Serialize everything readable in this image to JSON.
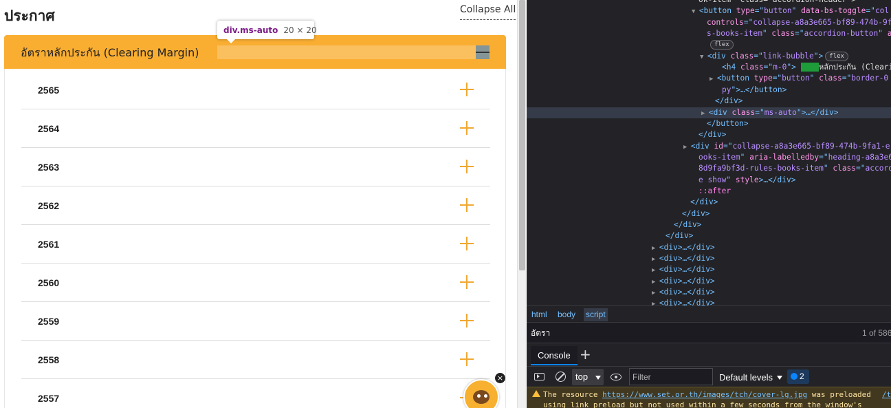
{
  "page": {
    "title": "ประกาศ",
    "collapse_all": "Collapse All",
    "tooltip": {
      "tag": "div",
      "class": ".ms-auto",
      "dims": "20 × 20"
    },
    "accordion": {
      "title": "อัตราหลักประกัน (Clearing Margin)",
      "years": [
        "2565",
        "2564",
        "2563",
        "2562",
        "2561",
        "2560",
        "2559",
        "2558",
        "2557"
      ]
    },
    "chat_close": "×",
    "colors": {
      "accent": "#f9ae32",
      "plus": "#f0a830"
    }
  },
  "devtools": {
    "dom_lines": [
      {
        "indent": 1016,
        "parts": [
          [
            "tx",
            "ok‑item\" class=\"accordion‑header\">"
          ]
        ]
      },
      {
        "indent": 1016,
        "tw": "▼",
        "parts": [
          [
            "tg",
            "<button "
          ],
          [
            "an",
            "type"
          ],
          [
            "tg",
            "=\""
          ],
          [
            "av",
            "button"
          ],
          [
            "tg",
            "\" "
          ],
          [
            "an",
            "data-bs-toggle"
          ],
          [
            "tg",
            "=\""
          ],
          [
            "av",
            "col"
          ]
        ]
      },
      {
        "indent": 1028,
        "parts": [
          [
            "an",
            "controls"
          ],
          [
            "tg",
            "=\""
          ],
          [
            "av",
            "collapse-a8a3e665-bf89-474b-9fa"
          ]
        ]
      },
      {
        "indent": 1028,
        "parts": [
          [
            "av",
            "s-books-item"
          ],
          [
            "tg",
            "\" "
          ],
          [
            "an",
            "class"
          ],
          [
            "tg",
            "=\""
          ],
          [
            "av",
            "accordion-button"
          ],
          [
            "tg",
            "\" "
          ],
          [
            "an",
            "ar"
          ]
        ]
      },
      {
        "indent": 1030,
        "badge": "flex"
      },
      {
        "indent": 1028,
        "tw": "▼",
        "parts": [
          [
            "tg",
            "<div "
          ],
          [
            "an",
            "class"
          ],
          [
            "tg",
            "=\""
          ],
          [
            "av",
            "link-bubble"
          ],
          [
            "tg",
            "\">"
          ]
        ],
        "badge": "flex"
      },
      {
        "indent": 1050,
        "parts": [
          [
            "tg",
            "<h4 "
          ],
          [
            "an",
            "class"
          ],
          [
            "tg",
            "=\""
          ],
          [
            "av",
            "m-0"
          ],
          [
            "tg",
            "\"> "
          ]
        ],
        "match": "อัตรา",
        "tail": "หลักประกัน (Cleari"
      },
      {
        "indent": 1042,
        "tw": "▶",
        "parts": [
          [
            "tg",
            "<button "
          ],
          [
            "an",
            "type"
          ],
          [
            "tg",
            "=\""
          ],
          [
            "av",
            "button"
          ],
          [
            "tg",
            "\" "
          ],
          [
            "an",
            "class"
          ],
          [
            "tg",
            "=\""
          ],
          [
            "av",
            "border-0"
          ]
        ]
      },
      {
        "indent": 1050,
        "parts": [
          [
            "av",
            "py"
          ],
          [
            "tg",
            "\">…</button>"
          ]
        ]
      },
      {
        "indent": 1040,
        "parts": [
          [
            "tg",
            "</div>"
          ]
        ]
      },
      {
        "indent": 1030,
        "tw": "▶",
        "sel": true,
        "parts": [
          [
            "tg",
            "<div "
          ],
          [
            "an",
            "class"
          ],
          [
            "tg",
            "=\""
          ],
          [
            "av",
            "ms-auto"
          ],
          [
            "tg",
            "\">…</div>"
          ]
        ]
      },
      {
        "indent": 1028,
        "parts": [
          [
            "tg",
            "</button>"
          ]
        ]
      },
      {
        "indent": 1016,
        "parts": [
          [
            "tg",
            "</div>"
          ]
        ]
      },
      {
        "indent": 1004,
        "tw": "▶",
        "parts": [
          [
            "tg",
            "<div "
          ],
          [
            "an",
            "id"
          ],
          [
            "tg",
            "=\""
          ],
          [
            "av",
            "collapse-a8a3e665-bf89-474b-9fa1-e"
          ]
        ]
      },
      {
        "indent": 1016,
        "parts": [
          [
            "av",
            "ooks-item"
          ],
          [
            "tg",
            "\" "
          ],
          [
            "an",
            "aria-labelledby"
          ],
          [
            "tg",
            "=\""
          ],
          [
            "av",
            "heading-a8a3e66"
          ]
        ]
      },
      {
        "indent": 1016,
        "parts": [
          [
            "av",
            "8d9fa9bf3d-rules-books-item"
          ],
          [
            "tg",
            "\" "
          ],
          [
            "an",
            "class"
          ],
          [
            "tg",
            "=\""
          ],
          [
            "av",
            "accordi"
          ]
        ]
      },
      {
        "indent": 1016,
        "parts": [
          [
            "av",
            "e show"
          ],
          [
            "tg",
            "\" "
          ],
          [
            "an",
            "style"
          ],
          [
            "tg",
            ">…</div>"
          ]
        ]
      },
      {
        "indent": 1016,
        "parts": [
          [
            "pe",
            "::after"
          ]
        ]
      },
      {
        "indent": 1004,
        "parts": [
          [
            "tg",
            "</div>"
          ]
        ]
      },
      {
        "indent": 992,
        "parts": [
          [
            "tg",
            "</div>"
          ]
        ]
      },
      {
        "indent": 980,
        "parts": [
          [
            "tg",
            "</div>"
          ]
        ]
      },
      {
        "indent": 968,
        "parts": [
          [
            "tg",
            "</div>"
          ]
        ]
      },
      {
        "indent": 958,
        "tw": "▶",
        "parts": [
          [
            "tg",
            "<div>…</div>"
          ]
        ]
      },
      {
        "indent": 958,
        "tw": "▶",
        "parts": [
          [
            "tg",
            "<div>…</div>"
          ]
        ]
      },
      {
        "indent": 958,
        "tw": "▶",
        "parts": [
          [
            "tg",
            "<div>…</div>"
          ]
        ]
      },
      {
        "indent": 958,
        "tw": "▶",
        "parts": [
          [
            "tg",
            "<div>…</div>"
          ]
        ]
      },
      {
        "indent": 958,
        "tw": "▶",
        "parts": [
          [
            "tg",
            "<div>…</div>"
          ]
        ]
      },
      {
        "indent": 958,
        "tw": "▶",
        "parts": [
          [
            "tg",
            "<div>…</div>"
          ]
        ]
      }
    ],
    "breadcrumbs": [
      "html",
      "body",
      "script"
    ],
    "search": {
      "value": "อัตรา",
      "count": "1 of 586"
    },
    "console_tab": "Console",
    "add_tab": "+",
    "context": "top",
    "filter_placeholder": "Filter",
    "levels": "Default levels",
    "message_count": "2",
    "warning": {
      "prefix": "The resource ",
      "link": "https://www.set.or.th/images/tch/cover-lg.jpg",
      "suffix": " was preloaded",
      "line2": "using link preload but not used within a few seconds from the window's",
      "source": "/t"
    }
  }
}
